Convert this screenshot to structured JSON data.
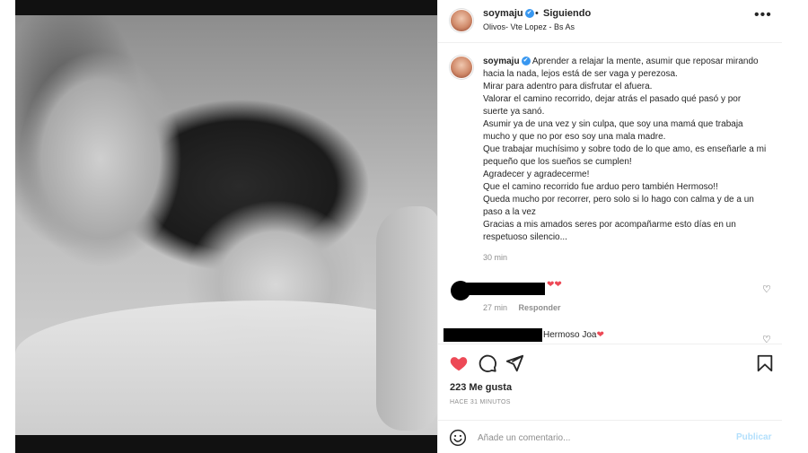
{
  "header": {
    "username": "soymaju",
    "verified_glyph": "✔",
    "separator": "•",
    "follow_status": "Siguiendo",
    "location": "Olivos- Vte Lopez - Bs As",
    "more_glyph": "•••"
  },
  "caption": {
    "username": "soymaju",
    "lines": [
      "Aprender a relajar la mente, asumir que reposar mirando hacia la nada, lejos está de ser vaga y perezosa.",
      "Mirar para adentro para disfrutar el afuera.",
      "Valorar el camino recorrido, dejar atrás el pasado qué pasó y por suerte ya sanó.",
      "Asumir ya de una vez y sin culpa, que soy una mamá que trabaja mucho y que no por eso soy una mala madre.",
      "Que trabajar muchísimo y sobre todo de lo que amo, es enseñarle a mi pequeño que los sueños se cumplen!",
      "Agradecer y agradecerme!",
      "Que el camino recorrido fue arduo pero también Hermoso!!",
      "Queda mucho por recorrer, pero solo si lo hago con calma y de a un paso a la vez",
      "Gracias a mis amados seres por acompañarme esto días en un respetuoso silencio..."
    ],
    "time": "30 min"
  },
  "comments": [
    {
      "text": "❤❤",
      "time": "27 min",
      "reply_label": "Responder"
    },
    {
      "text": "Hermoso Joa",
      "heart": "❤"
    }
  ],
  "actions": {
    "likes": "223 Me gusta",
    "posted_ago": "HACE 31 MINUTOS"
  },
  "composer": {
    "placeholder": "Añade un comentario...",
    "publish_label": "Publicar"
  },
  "colors": {
    "like_red": "#ed4956",
    "verified_blue": "#3897f0",
    "publish_disabled": "#b2dffc"
  },
  "icons": {
    "like": "heart-filled-icon",
    "comment": "speech-bubble-icon",
    "share": "paper-plane-icon",
    "save": "bookmark-icon",
    "emoji": "smiley-icon",
    "more": "ellipsis-icon",
    "comment_like": "heart-outline-icon"
  }
}
